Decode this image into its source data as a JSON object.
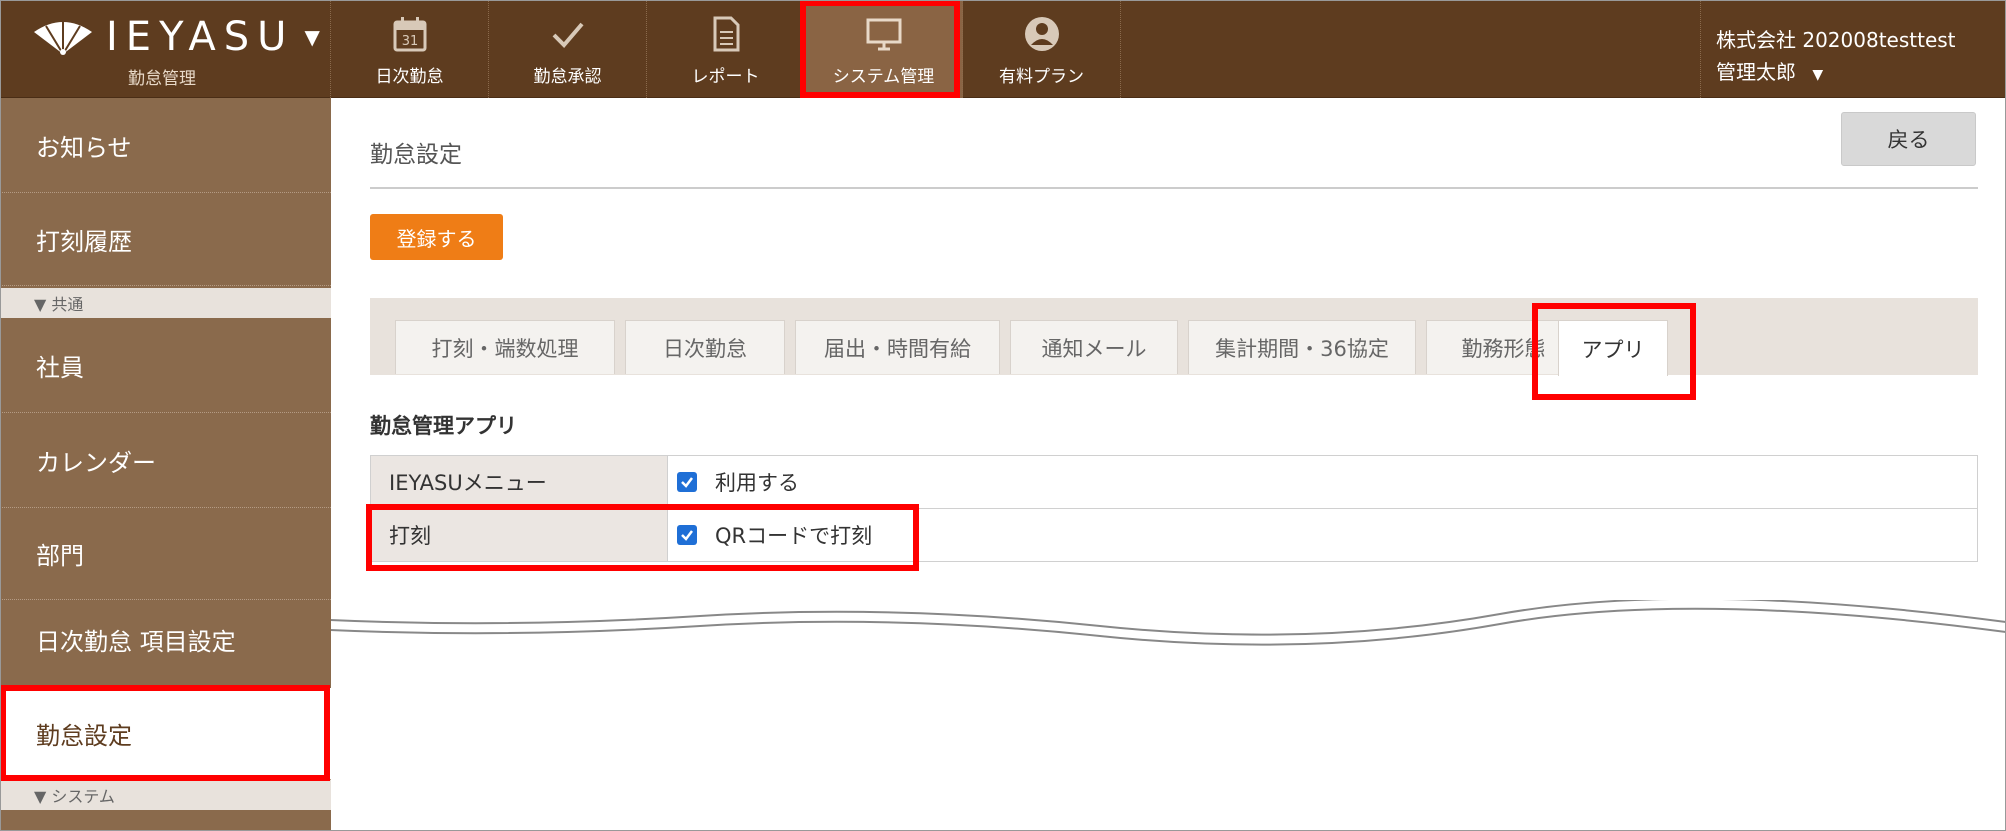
{
  "header": {
    "logo_text": "IEYASU",
    "logo_caret": "▼",
    "logo_sub": "勤怠管理",
    "nav": [
      {
        "label": "日次勤怠",
        "icon": "calendar-icon",
        "calendar_day": "31"
      },
      {
        "label": "勤怠承認",
        "icon": "checkmark-icon"
      },
      {
        "label": "レポート",
        "icon": "document-icon"
      },
      {
        "label": "システム管理",
        "icon": "monitor-icon",
        "active": true
      },
      {
        "label": "有料プラン",
        "icon": "user-icon"
      }
    ],
    "company": "株式会社 202008testtest",
    "username": "管理太郎",
    "user_caret": "▼"
  },
  "sidebar": {
    "items": [
      {
        "label": "お知らせ"
      },
      {
        "label": "打刻履歴"
      },
      {
        "section": "▼ 共通"
      },
      {
        "label": "社員"
      },
      {
        "label": "カレンダー"
      },
      {
        "label": "部門"
      },
      {
        "label": "日次勤怠 項目設定"
      },
      {
        "label": "勤怠設定",
        "active": true
      },
      {
        "section": "▼ システム"
      }
    ]
  },
  "main": {
    "title": "勤怠設定",
    "back_label": "戻る",
    "register_label": "登録する",
    "tabs": [
      {
        "label": "打刻・端数処理"
      },
      {
        "label": "日次勤怠"
      },
      {
        "label": "届出・時間有給"
      },
      {
        "label": "通知メール"
      },
      {
        "label": "集計期間・36協定"
      },
      {
        "label": "勤務形態"
      },
      {
        "label": "アプリ",
        "active": true
      }
    ],
    "section_title": "勤怠管理アプリ",
    "rows": [
      {
        "label": "IEYASUメニュー",
        "option": "利用する",
        "checked": true
      },
      {
        "label": "打刻",
        "option": "QRコードで打刻",
        "checked": true
      }
    ]
  },
  "colors": {
    "header_bg": "#5e3c1f",
    "sidebar_bg": "#8a6a4c",
    "accent_orange": "#ef7d16",
    "highlight_red": "#ff0000",
    "checkbox_blue": "#1f6fd6"
  }
}
